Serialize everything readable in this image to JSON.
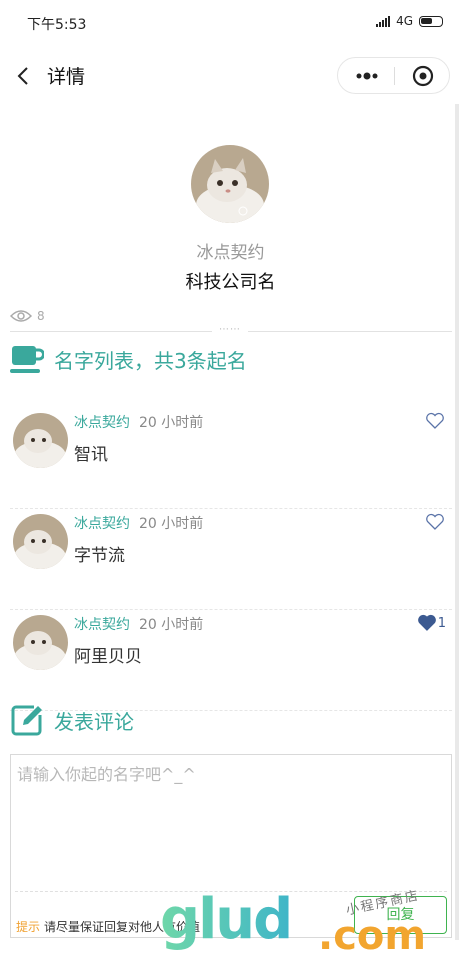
{
  "status_bar": {
    "time": "下午5:53",
    "network": "4G"
  },
  "navbar": {
    "title": "详情"
  },
  "profile": {
    "name": "冰点契约",
    "company": "科技公司名"
  },
  "views": {
    "count": "8"
  },
  "list_section": {
    "title": "名字列表，共3条起名"
  },
  "entries": [
    {
      "user": "冰点契约",
      "time": "20 小时前",
      "name": "智讯",
      "liked": false,
      "likes": ""
    },
    {
      "user": "冰点契约",
      "time": "20 小时前",
      "name": "字节流",
      "liked": false,
      "likes": ""
    },
    {
      "user": "冰点契约",
      "time": "20 小时前",
      "name": "阿里贝贝",
      "liked": true,
      "likes": "1"
    }
  ],
  "comment_section": {
    "title": "发表评论",
    "placeholder": "请输入你起的名字吧^_^",
    "hint_label": "提示",
    "hint_text": "请尽量保证回复对他人有价值",
    "reply_label": "回复"
  },
  "watermark": {
    "big": "glud",
    "com": ".com",
    "small": "小程序商店"
  },
  "colors": {
    "accent": "#3aa89c",
    "like": "#3c5a91",
    "reply": "#3fb34f",
    "hint": "#f0a030"
  }
}
